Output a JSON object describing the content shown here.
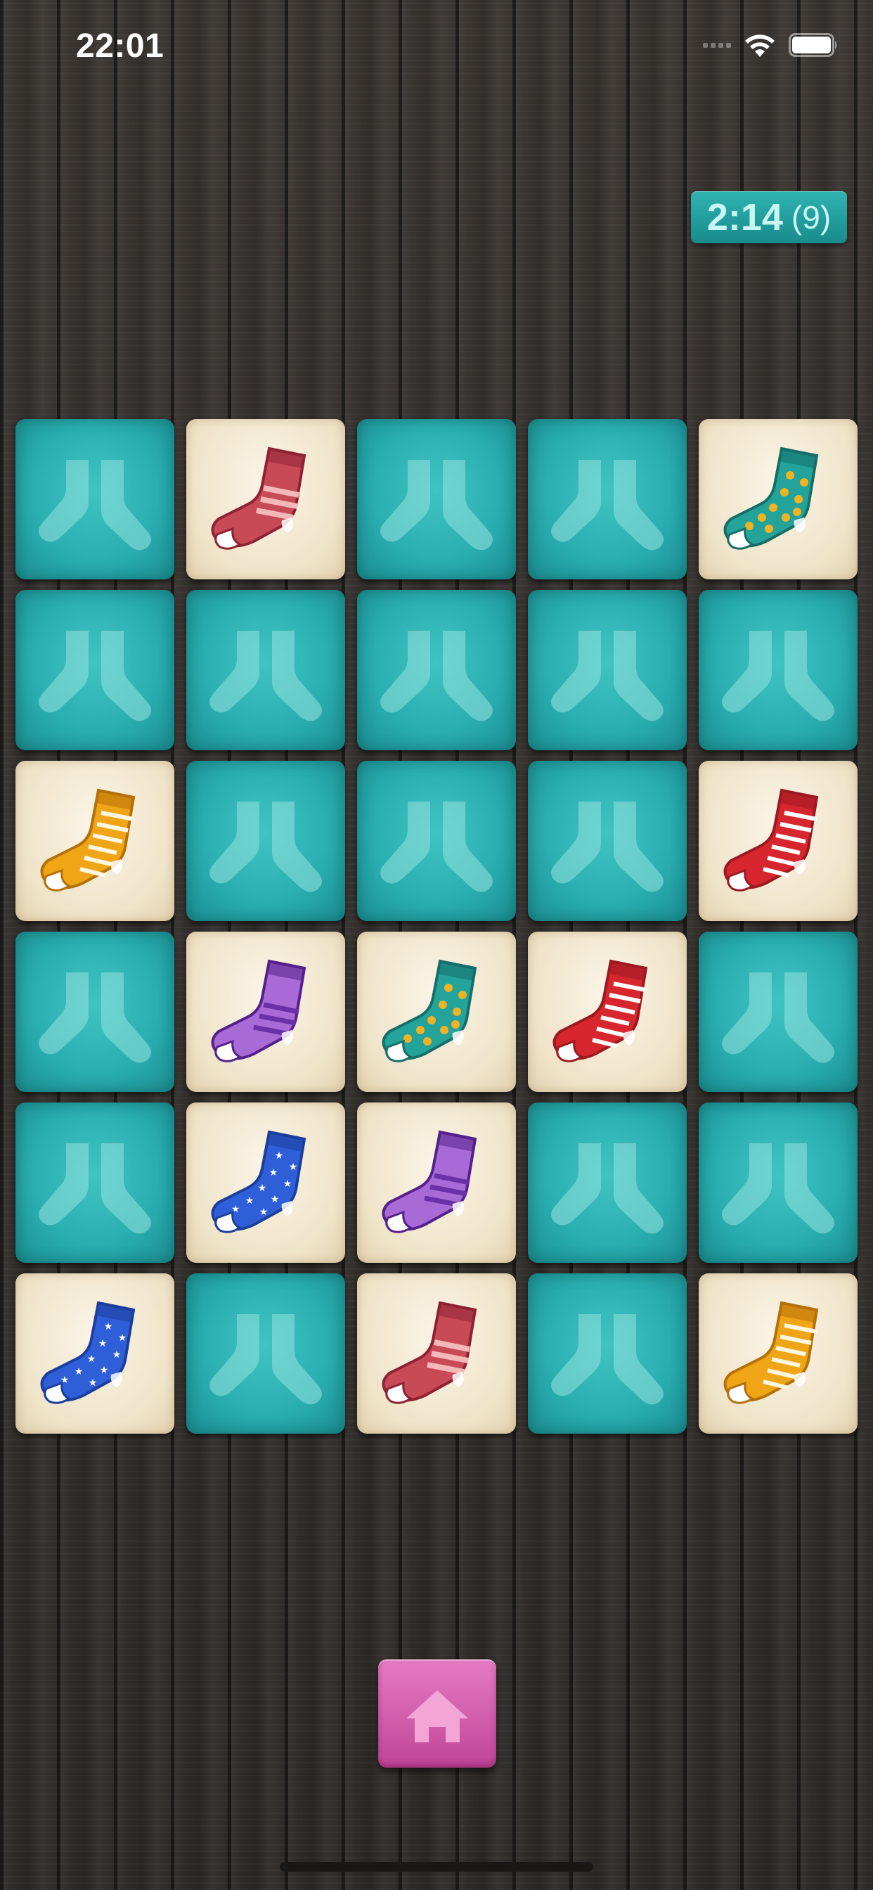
{
  "status_bar": {
    "time": "22:01",
    "icons": [
      "cellular-signal-icon",
      "wifi-icon",
      "battery-icon"
    ]
  },
  "timer": {
    "time": "2:14",
    "moves": "(9)"
  },
  "board": {
    "columns": 5,
    "rows": 6,
    "cards": [
      {
        "state": "down",
        "sock": null
      },
      {
        "state": "up",
        "sock": "red-sock"
      },
      {
        "state": "down",
        "sock": null
      },
      {
        "state": "down",
        "sock": null
      },
      {
        "state": "up",
        "sock": "teal-dotted-sock"
      },
      {
        "state": "down",
        "sock": null
      },
      {
        "state": "down",
        "sock": null
      },
      {
        "state": "down",
        "sock": null
      },
      {
        "state": "down",
        "sock": null
      },
      {
        "state": "down",
        "sock": null
      },
      {
        "state": "up",
        "sock": "orange-striped-sock"
      },
      {
        "state": "down",
        "sock": null
      },
      {
        "state": "down",
        "sock": null
      },
      {
        "state": "down",
        "sock": null
      },
      {
        "state": "up",
        "sock": "red-white-striped-sock"
      },
      {
        "state": "down",
        "sock": null
      },
      {
        "state": "up",
        "sock": "purple-sock"
      },
      {
        "state": "up",
        "sock": "teal-dotted-sock"
      },
      {
        "state": "up",
        "sock": "red-white-striped-sock"
      },
      {
        "state": "down",
        "sock": null
      },
      {
        "state": "down",
        "sock": null
      },
      {
        "state": "up",
        "sock": "blue-star-sock"
      },
      {
        "state": "up",
        "sock": "purple-sock"
      },
      {
        "state": "down",
        "sock": null
      },
      {
        "state": "down",
        "sock": null
      },
      {
        "state": "up",
        "sock": "blue-star-sock"
      },
      {
        "state": "down",
        "sock": null
      },
      {
        "state": "up",
        "sock": "red-sock"
      },
      {
        "state": "down",
        "sock": null
      },
      {
        "state": "up",
        "sock": "orange-striped-sock"
      }
    ]
  },
  "sock_colors": {
    "red-sock": {
      "main": "#c94a57",
      "accent": "#f3b9b7",
      "dark": "#8e2233"
    },
    "teal-dotted-sock": {
      "main": "#23a39a",
      "accent": "#f0b323",
      "dark": "#166e69"
    },
    "orange-striped-sock": {
      "main": "#f0a516",
      "accent": "#fff6df",
      "dark": "#b4700a"
    },
    "red-white-striped-sock": {
      "main": "#d7262e",
      "accent": "#ffffff",
      "dark": "#9b1a22"
    },
    "purple-sock": {
      "main": "#a76ad6",
      "accent": "#6b2fa6",
      "dark": "#55208a"
    },
    "blue-star-sock": {
      "main": "#2f5fd8",
      "accent": "#ffffff",
      "dark": "#1c3e9c"
    }
  },
  "card_back_color": "#2aaeb0",
  "home_button": {
    "icon": "home-icon"
  }
}
